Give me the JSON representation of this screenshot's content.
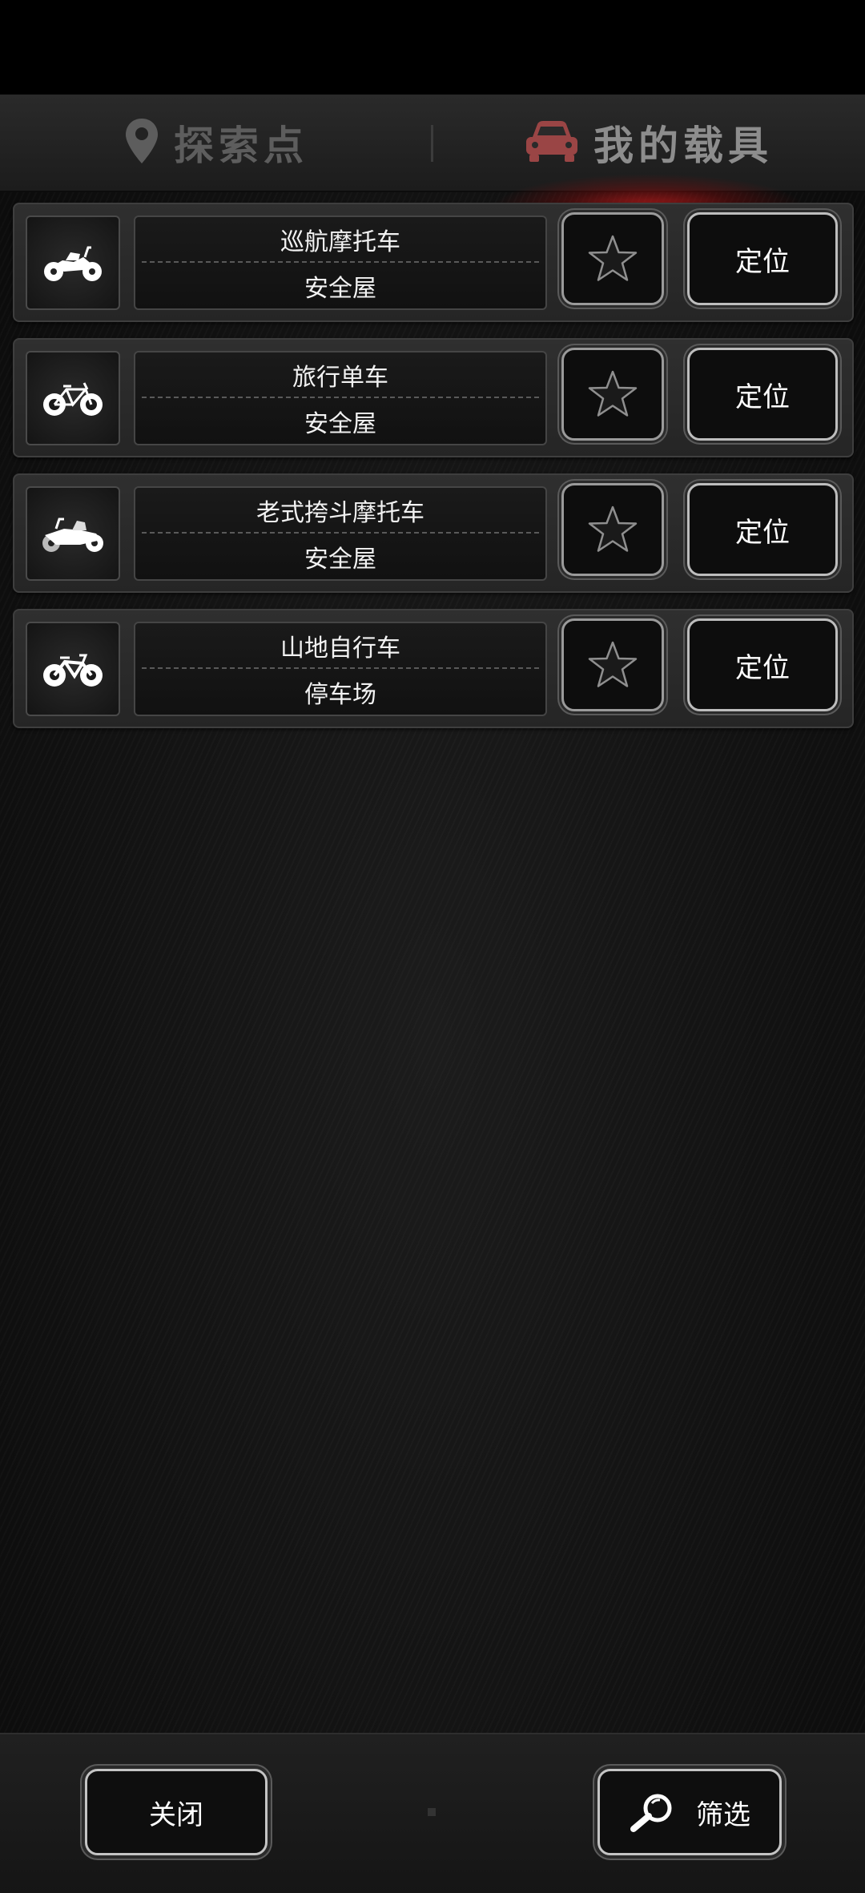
{
  "tabs": {
    "explore_label": "探索点",
    "vehicles_label": "我的载具",
    "active": "vehicles",
    "explore_icon": "location-pin-icon",
    "vehicles_icon": "car-icon"
  },
  "vehicles": [
    {
      "name": "巡航摩托车",
      "location": "安全屋",
      "icon": "cruiser-motorcycle-icon",
      "favorite": false,
      "locate_label": "定位"
    },
    {
      "name": "旅行单车",
      "location": "安全屋",
      "icon": "touring-bicycle-icon",
      "favorite": false,
      "locate_label": "定位"
    },
    {
      "name": "老式挎斗摩托车",
      "location": "安全屋",
      "icon": "sidecar-motorcycle-icon",
      "favorite": false,
      "locate_label": "定位"
    },
    {
      "name": "山地自行车",
      "location": "停车场",
      "icon": "mountain-bike-icon",
      "favorite": false,
      "locate_label": "定位"
    }
  ],
  "footer": {
    "close_label": "关闭",
    "filter_label": "筛选",
    "filter_icon": "magnifier-icon"
  },
  "colors": {
    "accent_glow": "#e61e1e",
    "tab_active_text": "#8d8d8d",
    "tab_inactive_text": "#5d5d5d",
    "text": "#f2f2f2"
  }
}
